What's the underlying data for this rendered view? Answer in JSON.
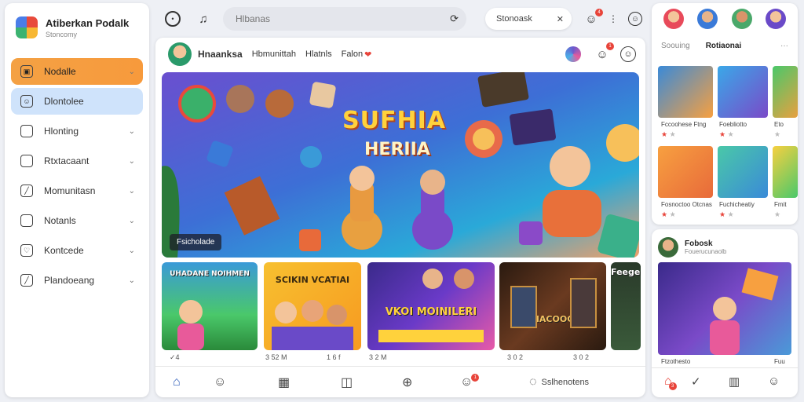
{
  "sidebar": {
    "brand_title": "Atiberkan Podalk",
    "brand_sub": "Stoncomy",
    "items": [
      {
        "label": "Nodalle",
        "icon": "game-icon"
      },
      {
        "label": "Dlontolee",
        "icon": "smile-icon"
      },
      {
        "label": "Hlonting",
        "icon": "calendar-icon"
      },
      {
        "label": "Rtxtacaant",
        "icon": "bookmark-icon"
      },
      {
        "label": "Momunitasn",
        "icon": "pencil-icon"
      },
      {
        "label": "Notanls",
        "icon": "tag-icon"
      },
      {
        "label": "Kontcede",
        "icon": "heart-icon"
      },
      {
        "label": "Plandoeang",
        "icon": "edit-icon"
      }
    ]
  },
  "topbar": {
    "search_placeholder": "Hlbanas",
    "pill_label": "Stonoask",
    "notif_count": "4"
  },
  "main": {
    "profile": {
      "name": "Hnaanksa",
      "links": [
        "Hbmunittah",
        "Hlatnls",
        "Falon"
      ],
      "notif_count": "1"
    },
    "hero": {
      "title": "SUFHIA",
      "subtitle": "HERIIA",
      "caption": "Fsicholade"
    },
    "thumbnails": [
      {
        "text": "UHADANE NOIHMEN",
        "meta": ""
      },
      {
        "text": "SCIKIN VCATIAI",
        "meta": "3 52 M"
      },
      {
        "text": "VKOI MOINILERI",
        "meta": "1 6 f"
      },
      {
        "text": "HACOOC",
        "meta": "3 2 M"
      },
      {
        "text": "Feegel",
        "meta": "3 0 2"
      }
    ],
    "thumb_meta_first": "✓4",
    "bottom_nav_label": "Sslhenotens",
    "bottom_badge": "1"
  },
  "right_top": {
    "tabs": [
      "Soouing",
      "Rotiaonai"
    ],
    "cards": [
      {
        "caption": "Fccoohese Ftng"
      },
      {
        "caption": "Foebliotto"
      },
      {
        "caption": "Eto"
      },
      {
        "caption": "Fosnoctoo Otcnas"
      },
      {
        "caption": "Fuchicheatiy"
      },
      {
        "caption": "Fmit"
      }
    ]
  },
  "right_bottom": {
    "name": "Fobosk",
    "sub": "Fouerucunaolb",
    "caption_left": "Ftzothesto",
    "caption_right": "Fuu",
    "notif_count": "3"
  },
  "colors": {
    "accent_orange": "#f4a144",
    "accent_blue": "#cfe3fb",
    "badge_red": "#e8443a"
  }
}
